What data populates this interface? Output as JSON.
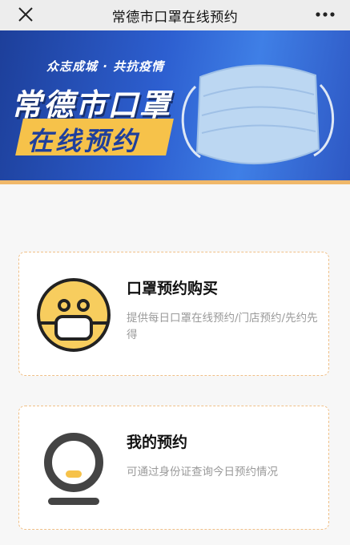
{
  "header": {
    "title": "常德市口罩在线预约",
    "close_icon": "close-icon",
    "more_icon": "more-dots-icon"
  },
  "banner": {
    "slogan": "众志成城 · 共抗疫情",
    "title": "常德市口罩",
    "subtitle": "在线预约",
    "colors": {
      "background": "#2d5fd0",
      "badge": "#f6c24a",
      "stripe": "#f0b86a"
    }
  },
  "cards": [
    {
      "title": "口罩预约购买",
      "desc": "提供每日口罩在线预约/门店预约/先约先得",
      "icon": "masked-face-icon"
    },
    {
      "title": "我的预约",
      "desc": "可通过身份证查询今日预约情况",
      "icon": "user-profile-icon"
    }
  ]
}
